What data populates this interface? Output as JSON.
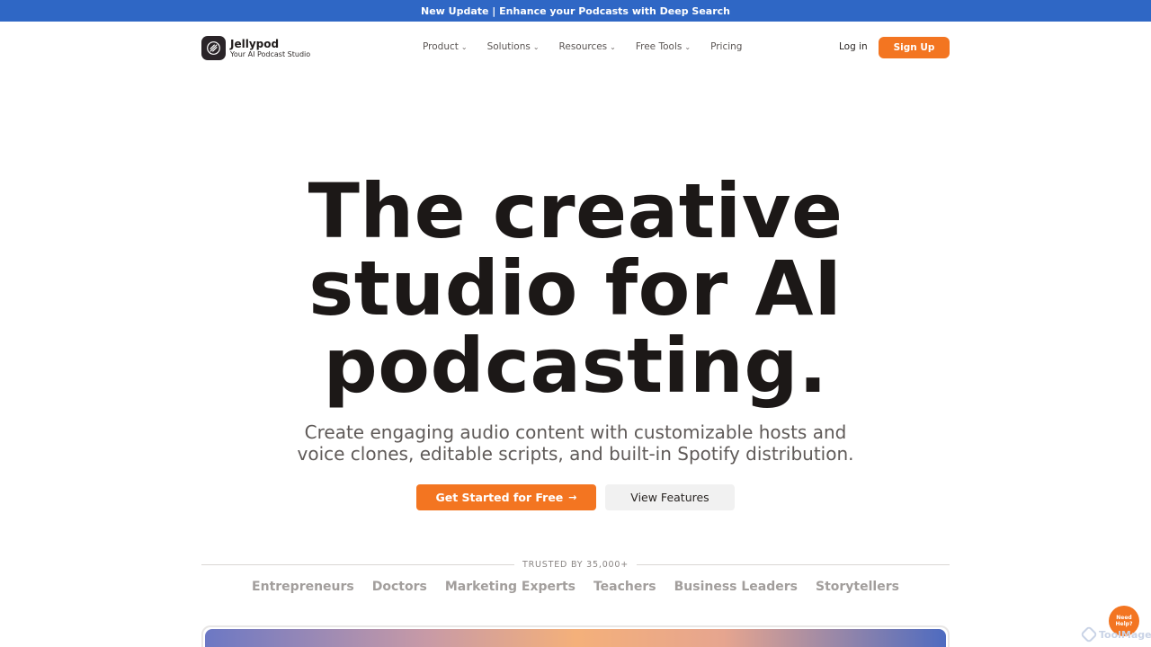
{
  "announcement": {
    "text": "New Update | Enhance your Podcasts with Deep Search"
  },
  "brand": {
    "name": "Jellypod",
    "tagline": "Your AI Podcast Studio",
    "icon": "jellypod-logo-icon"
  },
  "nav": {
    "items": [
      {
        "label": "Product",
        "has_dropdown": true
      },
      {
        "label": "Solutions",
        "has_dropdown": true
      },
      {
        "label": "Resources",
        "has_dropdown": true
      },
      {
        "label": "Free Tools",
        "has_dropdown": true
      },
      {
        "label": "Pricing",
        "has_dropdown": false
      }
    ],
    "chevron": "⌄",
    "login_label": "Log in",
    "signup_label": "Sign Up"
  },
  "hero": {
    "title_line1": "The creative",
    "title_line2": "studio for AI",
    "title_line3": "podcasting.",
    "subtitle_line1": "Create engaging audio content with customizable hosts and",
    "subtitle_line2": "voice clones, editable scripts, and built-in Spotify distribution.",
    "cta_primary": "Get Started for Free",
    "cta_primary_icon": "→",
    "cta_secondary": "View Features"
  },
  "trusted": {
    "label": "TRUSTED BY 35,000+",
    "audiences": [
      "Entrepreneurs",
      "Doctors",
      "Marketing Experts",
      "Teachers",
      "Business Leaders",
      "Storytellers"
    ]
  },
  "help": {
    "line1": "Need",
    "line2": "Help?"
  },
  "watermark": {
    "text": "ToolMage"
  },
  "colors": {
    "accent": "#f37521",
    "banner": "#2f67c5",
    "text_dark": "#1c1817",
    "text_muted": "#5f5a58"
  }
}
